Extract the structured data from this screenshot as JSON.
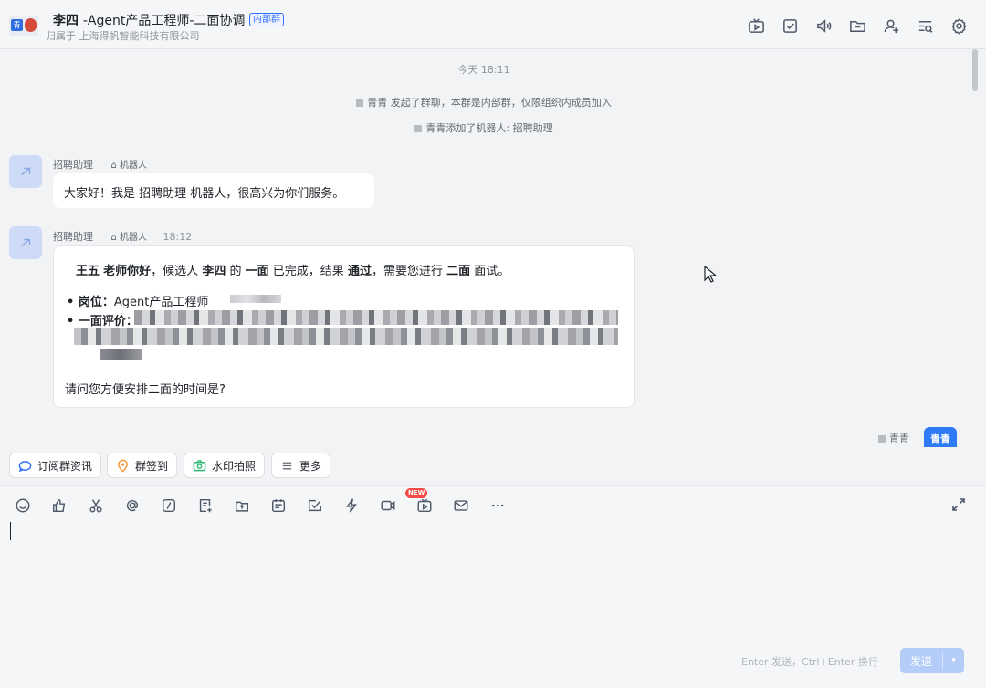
{
  "header": {
    "name": "李四",
    "title_rest": "-Agent产品工程师-二面协调",
    "internal_tag": "内部群",
    "subtitle": "归属于 上海得帆智能科技有限公司"
  },
  "messages": {
    "time_divider": "今天 18:11",
    "system_1": "青青 发起了群聊，本群是内部群，仅限组织内成员加入",
    "system_2": "青青添加了机器人: 招聘助理",
    "msg1": {
      "sender": "招聘助理",
      "tag": "机器人",
      "text": "大家好！我是 招聘助理 机器人，很高兴为你们服务。"
    },
    "msg2": {
      "sender": "招聘助理",
      "tag": "机器人",
      "time": "18:12",
      "interviewer": "王五",
      "greeting": "老师你好",
      "candidate_prefix": "，候选人",
      "candidate": "李四",
      "stage_prefix": "的",
      "stage": "一面",
      "result_prefix": "已完成，结果",
      "result": "通过",
      "next_prefix": "，需要您进行",
      "next_stage": "二面",
      "next_suffix": "面试。",
      "position_label": "• 岗位：",
      "position_value": "Agent产品工程师",
      "eval_label": "• 一面评价：",
      "question": "请问您方便安排二面的时间是?"
    },
    "self": {
      "name": "青青",
      "avatar_text": "青青"
    }
  },
  "quick_actions": [
    {
      "label": "订阅群资讯"
    },
    {
      "label": "群签到"
    },
    {
      "label": "水印拍照"
    },
    {
      "label": "更多"
    }
  ],
  "editor": {
    "new_badge": "NEW",
    "send_hint": "Enter 发送，Ctrl+Enter 换行",
    "send_label": "发送"
  },
  "colors": {
    "accent": "#3370ff",
    "send_disabled": "#b3ccf8",
    "self_avatar": "#2f7bf5"
  }
}
